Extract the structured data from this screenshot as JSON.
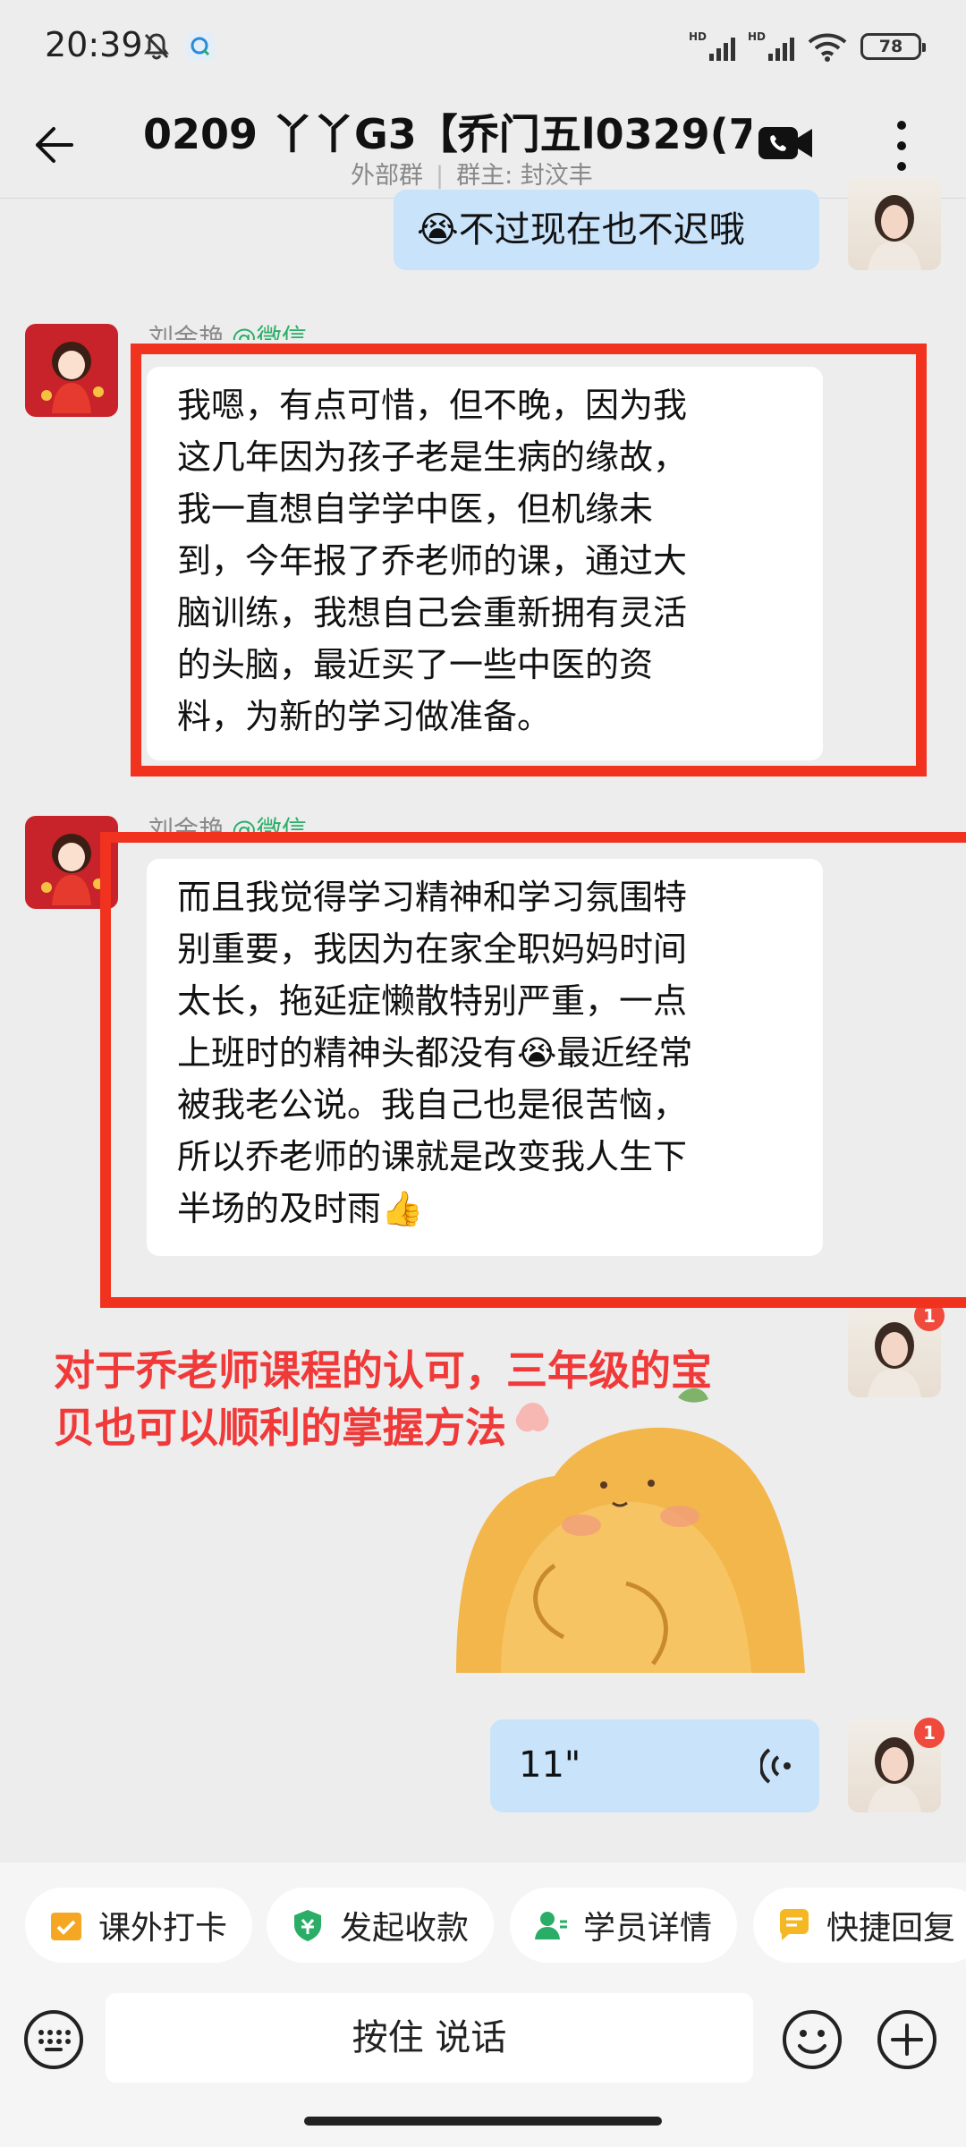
{
  "status_bar": {
    "time": "20:39",
    "battery": "78",
    "network_label": "HD"
  },
  "header": {
    "title": "0209 丫丫G3【乔门五l0329(7)",
    "group_type": "外部群",
    "owner": "群主: 封汶丰"
  },
  "messages": {
    "m1": {
      "text": "😭不过现在也不迟哦"
    },
    "m2": {
      "sender": "刘金艳",
      "sender_tag": "@微信",
      "lines": [
        "我嗯，有点可惜，但不晚，因为我",
        "这几年因为孩子老是生病的缘故，",
        "我一直想自学学中医，但机缘未",
        "到，今年报了乔老师的课，通过大",
        "脑训练，我想自己会重新拥有灵活",
        "的头脑，最近买了一些中医的资",
        "料，为新的学习做准备。"
      ]
    },
    "m3": {
      "sender": "刘金艳",
      "sender_tag": "@微信",
      "lines": [
        "而且我觉得学习精神和学习氛围特",
        "别重要，我因为在家全职妈妈时间",
        "太长，拖延症懒散特别严重，一点",
        "上班时的精神头都没有😭最近经常",
        "被我老公说。我自己也是很苦恼，",
        "所以乔老师的课就是改变我人生下",
        "半场的及时雨👍"
      ]
    },
    "m4": {
      "badge": "1"
    },
    "m5": {
      "duration": "11\"",
      "badge": "1"
    }
  },
  "annotation": {
    "line1": "对于乔老师课程的认可，三年级的宝",
    "line2": "贝也可以顺利的掌握方法"
  },
  "quick_actions": [
    "课外打卡",
    "发起收款",
    "学员详情",
    "快捷回复"
  ],
  "input": {
    "hold_to_talk": "按住 说话"
  },
  "colors": {
    "accent_red": "#f0321f",
    "bubble_out": "#c9e3fb",
    "wechat_green": "#2aae67",
    "badge_red": "#f04a3c"
  }
}
